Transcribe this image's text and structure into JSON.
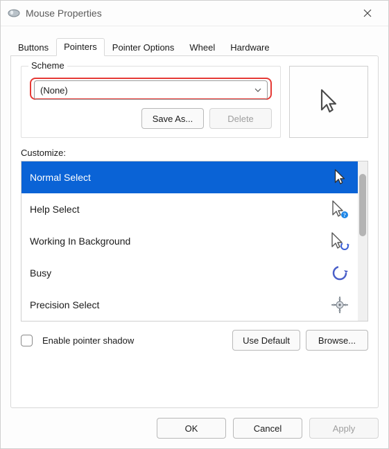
{
  "window": {
    "title": "Mouse Properties"
  },
  "tabs": [
    {
      "label": "Buttons",
      "active": false
    },
    {
      "label": "Pointers",
      "active": true
    },
    {
      "label": "Pointer Options",
      "active": false
    },
    {
      "label": "Wheel",
      "active": false
    },
    {
      "label": "Hardware",
      "active": false
    }
  ],
  "scheme": {
    "group_label": "Scheme",
    "selected": "(None)",
    "save_as_label": "Save As...",
    "delete_label": "Delete",
    "delete_enabled": false
  },
  "customize": {
    "label": "Customize:",
    "items": [
      {
        "name": "Normal Select",
        "icon": "cursor-arrow",
        "selected": true
      },
      {
        "name": "Help Select",
        "icon": "cursor-help",
        "selected": false
      },
      {
        "name": "Working In Background",
        "icon": "cursor-working",
        "selected": false
      },
      {
        "name": "Busy",
        "icon": "cursor-busy",
        "selected": false
      },
      {
        "name": "Precision Select",
        "icon": "cursor-precision",
        "selected": false
      }
    ]
  },
  "options": {
    "enable_shadow_label": "Enable pointer shadow",
    "enable_shadow_checked": false,
    "use_default_label": "Use Default",
    "browse_label": "Browse..."
  },
  "dialog": {
    "ok": "OK",
    "cancel": "Cancel",
    "apply": "Apply",
    "apply_enabled": false
  }
}
